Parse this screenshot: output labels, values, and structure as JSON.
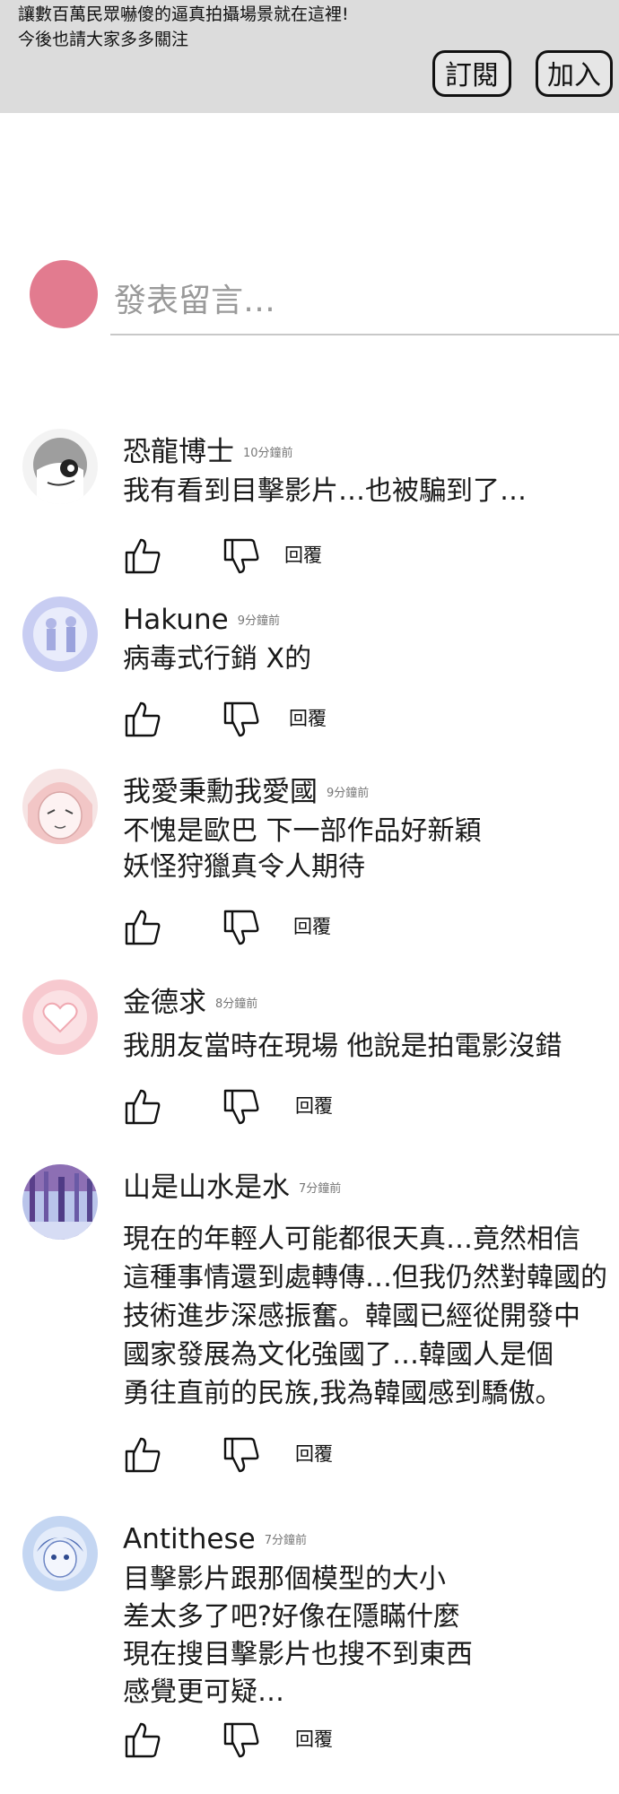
{
  "channel": {
    "description_lines": [
      "讓數百萬民眾嚇傻的逼真拍攝場景就在這裡!",
      "今後也請大家多多關注"
    ],
    "subscribe_label": "訂閱",
    "join_label": "加入"
  },
  "composer": {
    "placeholder": "發表留言…",
    "avatar_color": "#e27b8f"
  },
  "reply_label": "回覆",
  "comments": [
    {
      "author": "恐龍博士",
      "time": "10分鐘前",
      "lines": [
        "我有看到目擊影片…也被騙到了…"
      ],
      "avatar": "dinosaur-avatar"
    },
    {
      "author": "Hakune",
      "time": "9分鐘前",
      "lines": [
        "病毒式行銷 X的"
      ],
      "avatar": "couple-avatar"
    },
    {
      "author": "我愛秉勳我愛國",
      "time": "9分鐘前",
      "lines": [
        "不愧是歐巴 下一部作品好新穎",
        "妖怪狩獵真令人期待"
      ],
      "avatar": "anime-face-avatar"
    },
    {
      "author": "金德求",
      "time": "8分鐘前",
      "lines": [
        "我朋友當時在現場 他說是拍電影沒錯"
      ],
      "avatar": "heart-avatar"
    },
    {
      "author": "山是山水是水",
      "time": "7分鐘前",
      "lines": [
        "現在的年輕人可能都很天真…竟然相信",
        "這種事情還到處轉傳…但我仍然對韓國的",
        "技術進步深感振奮。韓國已經從開發中",
        "國家發展為文化強國了…韓國人是個",
        "勇往直前的民族,我為韓國感到驕傲。"
      ],
      "avatar": "forest-avatar"
    },
    {
      "author": "Antithese",
      "time": "7分鐘前",
      "lines": [
        "目擊影片跟那個模型的大小",
        "差太多了吧?好像在隱瞞什麼",
        "現在搜目擊影片也搜不到東西",
        "感覺更可疑…"
      ],
      "avatar": "blue-character-avatar"
    }
  ]
}
